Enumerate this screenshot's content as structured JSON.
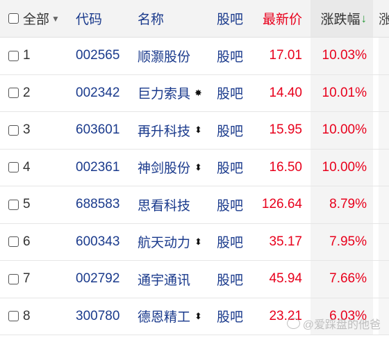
{
  "header": {
    "select_all": "全部",
    "code": "代码",
    "name": "名称",
    "ba": "股吧",
    "price": "最新价",
    "change": "涨跌幅",
    "change_sort": "↓",
    "next_col": "涨"
  },
  "rows": [
    {
      "idx": "1",
      "code": "002565",
      "name": "顺灏股份",
      "ba": "股吧",
      "price": "17.01",
      "change": "10.03%",
      "icon": ""
    },
    {
      "idx": "2",
      "code": "002342",
      "name": "巨力索具",
      "ba": "股吧",
      "price": "14.40",
      "change": "10.01%",
      "icon": "✸"
    },
    {
      "idx": "3",
      "code": "603601",
      "name": "再升科技",
      "ba": "股吧",
      "price": "15.95",
      "change": "10.00%",
      "icon": "⬍"
    },
    {
      "idx": "4",
      "code": "002361",
      "name": "神剑股份",
      "ba": "股吧",
      "price": "16.50",
      "change": "10.00%",
      "icon": "⬍"
    },
    {
      "idx": "5",
      "code": "688583",
      "name": "思看科技",
      "ba": "股吧",
      "price": "126.64",
      "change": "8.79%",
      "icon": ""
    },
    {
      "idx": "6",
      "code": "600343",
      "name": "航天动力",
      "ba": "股吧",
      "price": "35.17",
      "change": "7.95%",
      "icon": "⬍"
    },
    {
      "idx": "7",
      "code": "002792",
      "name": "通宇通讯",
      "ba": "股吧",
      "price": "45.94",
      "change": "7.66%",
      "icon": ""
    },
    {
      "idx": "8",
      "code": "300780",
      "name": "德恩精工",
      "ba": "股吧",
      "price": "23.21",
      "change": "6.03%",
      "icon": "⬍"
    }
  ],
  "watermark": "@爱踩盘的他爸",
  "colors": {
    "up": "#e8001c",
    "link": "#1a3a8c",
    "sort_arrow": "#2a9a3a"
  }
}
